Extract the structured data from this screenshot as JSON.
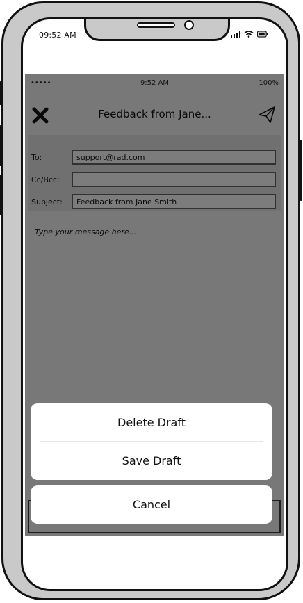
{
  "device": {
    "time": "09:52 AM",
    "signal_icon": "signal-bars-icon",
    "wifi_icon": "wifi-icon",
    "battery_icon": "battery-icon"
  },
  "app_status": {
    "carrier": "•••••",
    "time": "9:52 AM",
    "battery": "100%"
  },
  "navbar": {
    "title": "Feedback from Jane...",
    "close_icon": "close-x-icon",
    "send_icon": "paper-plane-icon"
  },
  "fields": {
    "to_label": "To:",
    "to_value": "support@rad.com",
    "cc_label": "Cc/Bcc:",
    "cc_value": "",
    "subject_label": "Subject:",
    "subject_value": "Feedback from Jane Smith"
  },
  "body": {
    "placeholder": "Type your message here..."
  },
  "action_sheet": {
    "delete_label": "Delete Draft",
    "save_label": "Save Draft",
    "cancel_label": "Cancel"
  }
}
